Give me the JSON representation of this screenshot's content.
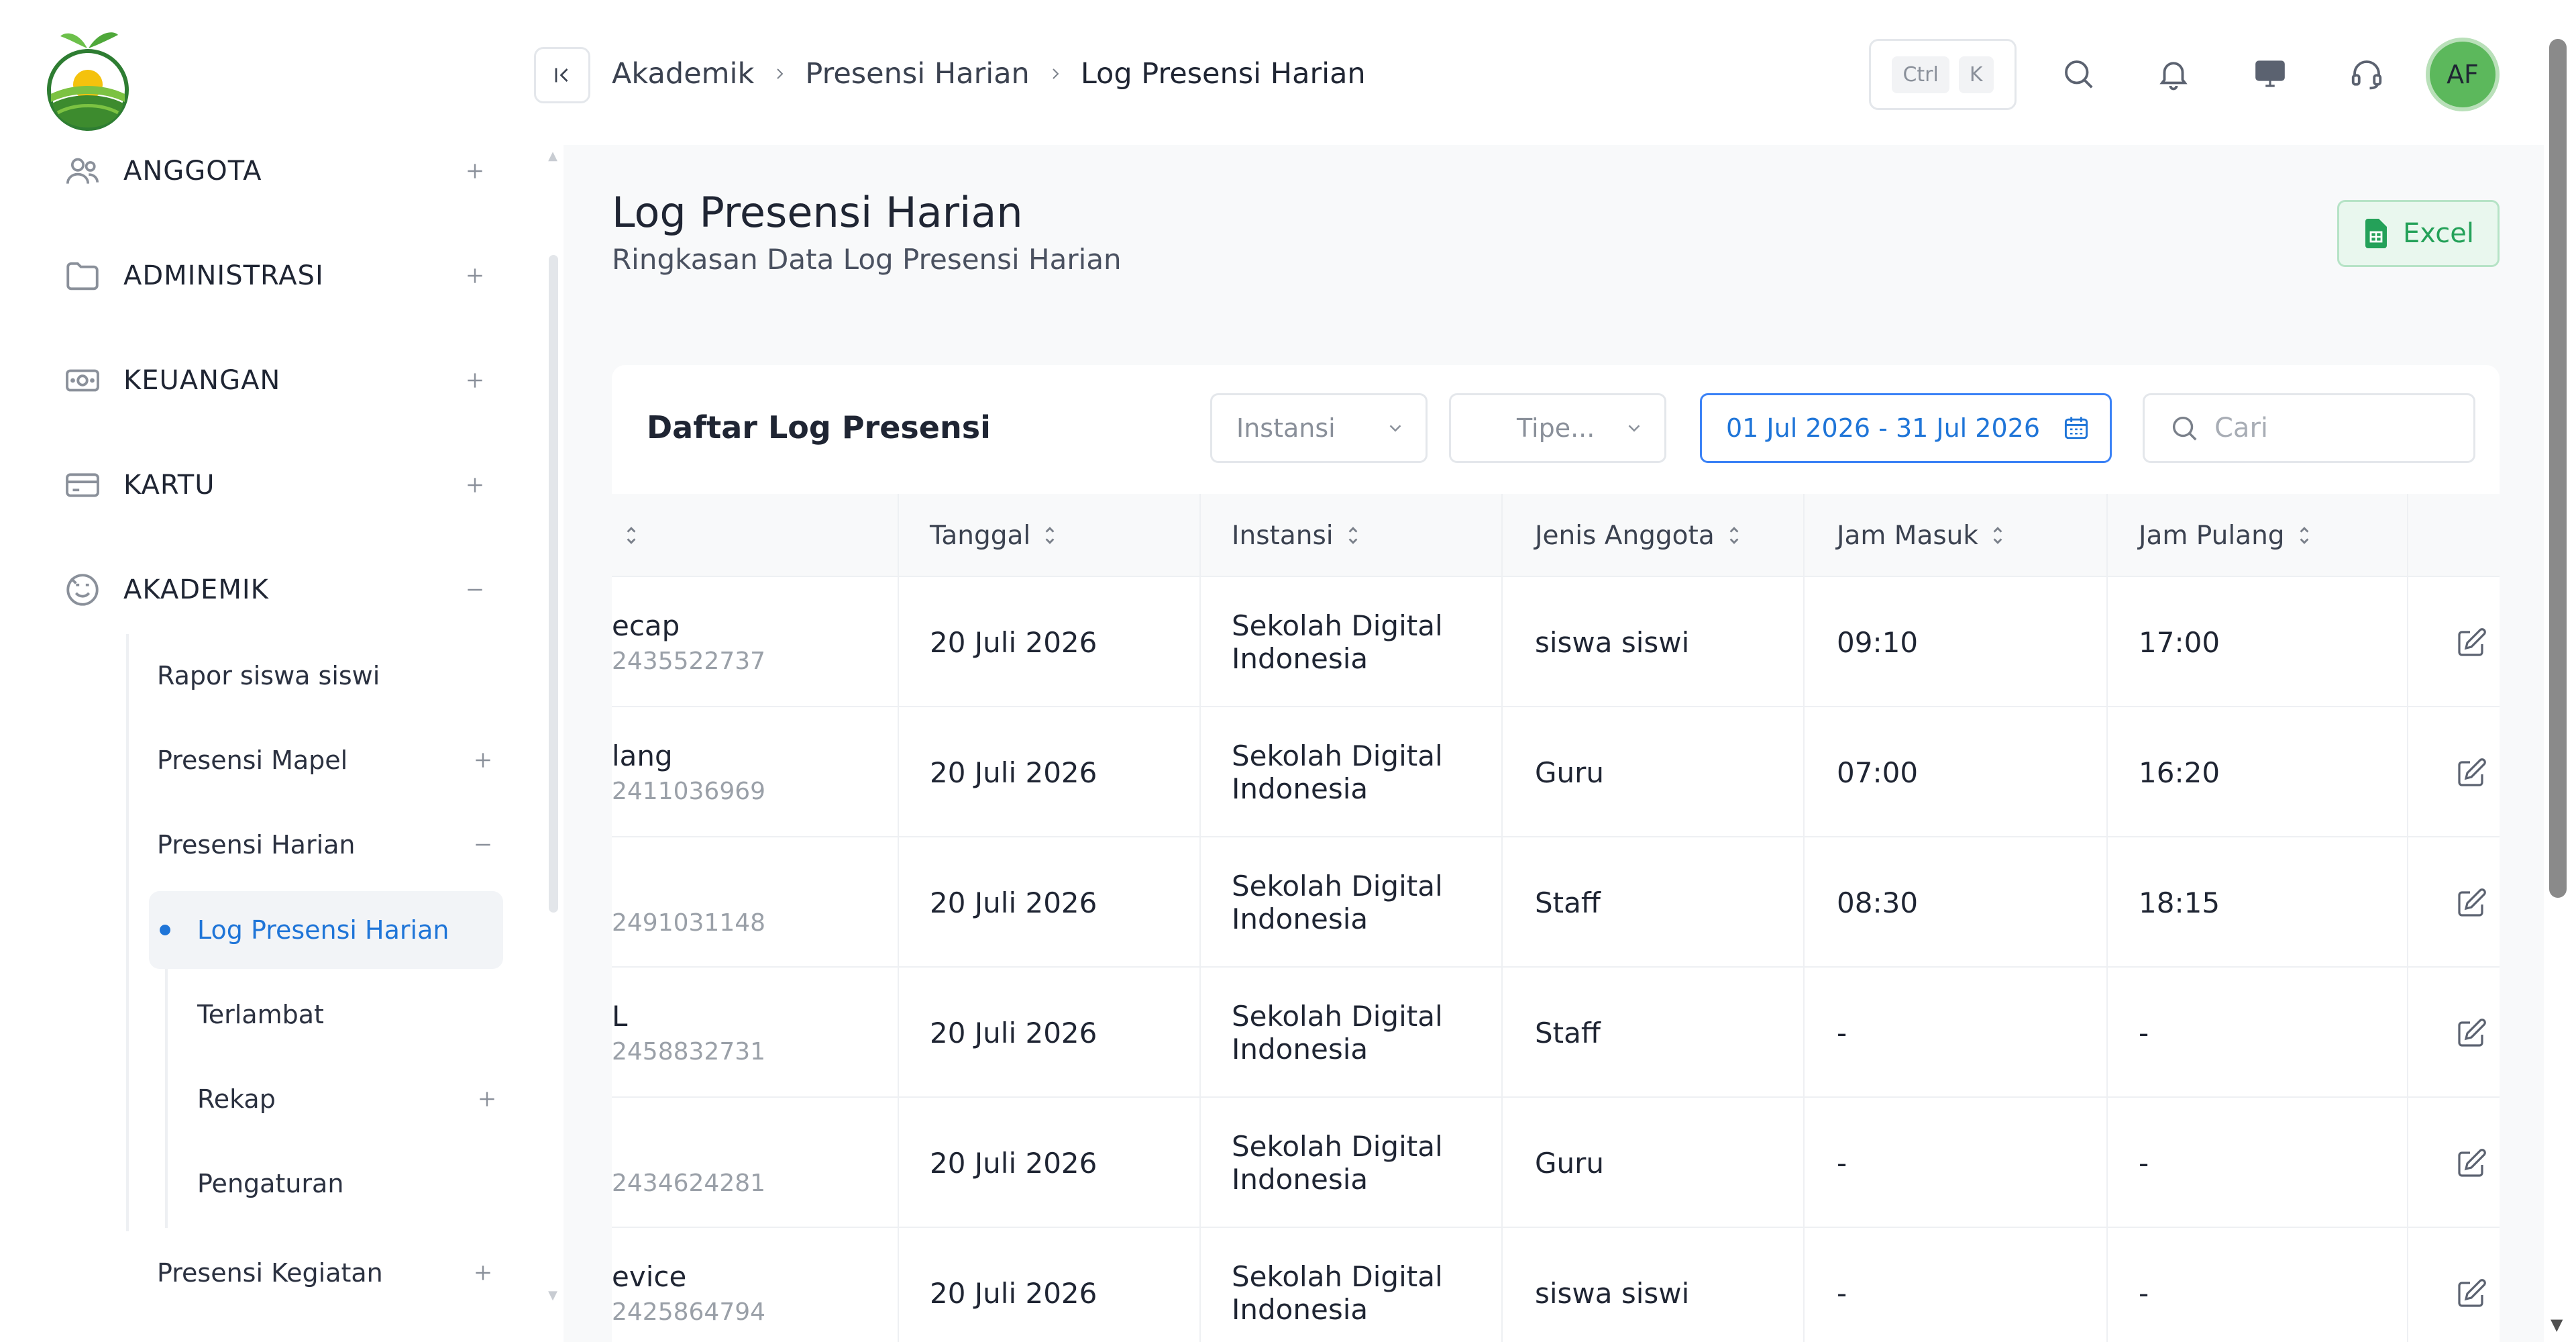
{
  "sidebar": {
    "sections": [
      {
        "label": "ANGGOTA",
        "icon": "users-icon",
        "toggle": "+"
      },
      {
        "label": "ADMINISTRASI",
        "icon": "folder-icon",
        "toggle": "+"
      },
      {
        "label": "KEUANGAN",
        "icon": "money-icon",
        "toggle": "+"
      },
      {
        "label": "KARTU",
        "icon": "card-icon",
        "toggle": "+"
      },
      {
        "label": "AKADEMIK",
        "icon": "academic-icon",
        "toggle": "−"
      }
    ],
    "akademik_items": [
      {
        "label": "Rapor siswa siswi"
      },
      {
        "label": "Presensi Mapel"
      },
      {
        "label": "Presensi Harian"
      },
      {
        "label": "Presensi Kegiatan"
      }
    ],
    "presensi_harian_items": [
      {
        "label": "Log Presensi Harian",
        "active": true
      },
      {
        "label": "Terlambat"
      },
      {
        "label": "Rekap"
      },
      {
        "label": "Pengaturan"
      }
    ]
  },
  "header": {
    "breadcrumb": [
      "Akademik",
      "Presensi Harian",
      "Log Presensi Harian"
    ],
    "shortcut": [
      "Ctrl",
      "K"
    ],
    "avatar_initials": "AF",
    "icons": [
      "search-icon",
      "bell-icon",
      "monitor-icon",
      "headset-icon"
    ]
  },
  "page": {
    "title": "Log Presensi Harian",
    "subtitle": "Ringkasan Data Log Presensi Harian",
    "excel_label": "Excel"
  },
  "card": {
    "title": "Daftar Log Presensi",
    "filter_instansi": "Instansi",
    "filter_tipe": "Tipe...",
    "date_range": "01 Jul 2026 - 31 Jul 2026",
    "search_placeholder": "Cari"
  },
  "table": {
    "columns": [
      "Tanggal",
      "Instansi",
      "Jenis Anggota",
      "Jam Masuk",
      "Jam Pulang"
    ],
    "rows": [
      {
        "name": "ecap",
        "id": "2435522737",
        "tanggal": "20 Juli 2026",
        "instansi1": "Sekolah Digital",
        "instansi2": "Indonesia",
        "jenis": "siswa siswi",
        "masuk": "09:10",
        "pulang": "17:00"
      },
      {
        "name": "lang",
        "id": "2411036969",
        "tanggal": "20 Juli 2026",
        "instansi1": "Sekolah Digital",
        "instansi2": "Indonesia",
        "jenis": "Guru",
        "masuk": "07:00",
        "pulang": "16:20"
      },
      {
        "name": "",
        "id": "2491031148",
        "tanggal": "20 Juli 2026",
        "instansi1": "Sekolah Digital",
        "instansi2": "Indonesia",
        "jenis": "Staff",
        "masuk": "08:30",
        "pulang": "18:15"
      },
      {
        "name": "L",
        "id": "2458832731",
        "tanggal": "20 Juli 2026",
        "instansi1": "Sekolah Digital",
        "instansi2": "Indonesia",
        "jenis": "Staff",
        "masuk": "-",
        "pulang": "-"
      },
      {
        "name": "",
        "id": "2434624281",
        "tanggal": "20 Juli 2026",
        "instansi1": "Sekolah Digital",
        "instansi2": "Indonesia",
        "jenis": "Guru",
        "masuk": "-",
        "pulang": "-"
      },
      {
        "name": "evice",
        "id": "2425864794",
        "tanggal": "20 Juli 2026",
        "instansi1": "Sekolah Digital",
        "instansi2": "Indonesia",
        "jenis": "siswa siswi",
        "masuk": "-",
        "pulang": "-"
      }
    ]
  },
  "colors": {
    "accent": "#1f75d8",
    "excel_green": "#24a159",
    "avatar_green": "#5cb85c"
  }
}
